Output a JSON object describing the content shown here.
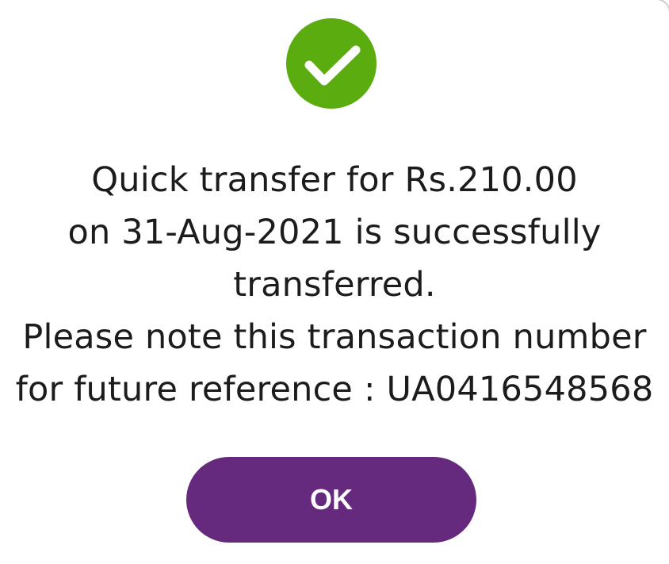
{
  "dialog": {
    "icon": "check-circle-icon",
    "accent_color": "#5aac0f",
    "button_color": "#65297d",
    "message_lines": [
      "Quick transfer for Rs.210.00",
      "on 31-Aug-2021 is successfully",
      "transferred.",
      "Please note this transaction number",
      "for future reference : UA0416548568"
    ],
    "ok_label": "OK"
  }
}
